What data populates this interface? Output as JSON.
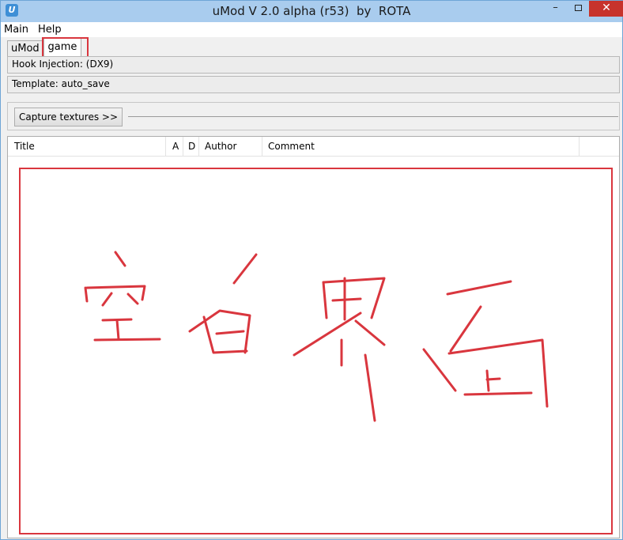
{
  "window": {
    "title": "uMod V 2.0 alpha (r53)  by  ROTA",
    "icon": "umod-app-icon",
    "controls": {
      "minimize": "–",
      "close": "✕"
    }
  },
  "menu": {
    "items": [
      "Main",
      "Help"
    ]
  },
  "tabs": {
    "items": [
      "uMod",
      "game"
    ],
    "active": "game"
  },
  "info": {
    "hook_injection": "Hook Injection:  (DX9)",
    "template": "Template: auto_save"
  },
  "capture": {
    "button_label": "Capture textures >>"
  },
  "list": {
    "columns": [
      "Title",
      "A",
      "D",
      "Author",
      "Comment"
    ],
    "rows": []
  },
  "annotation": {
    "color": "#d9363e",
    "handwriting": "空白界面"
  }
}
